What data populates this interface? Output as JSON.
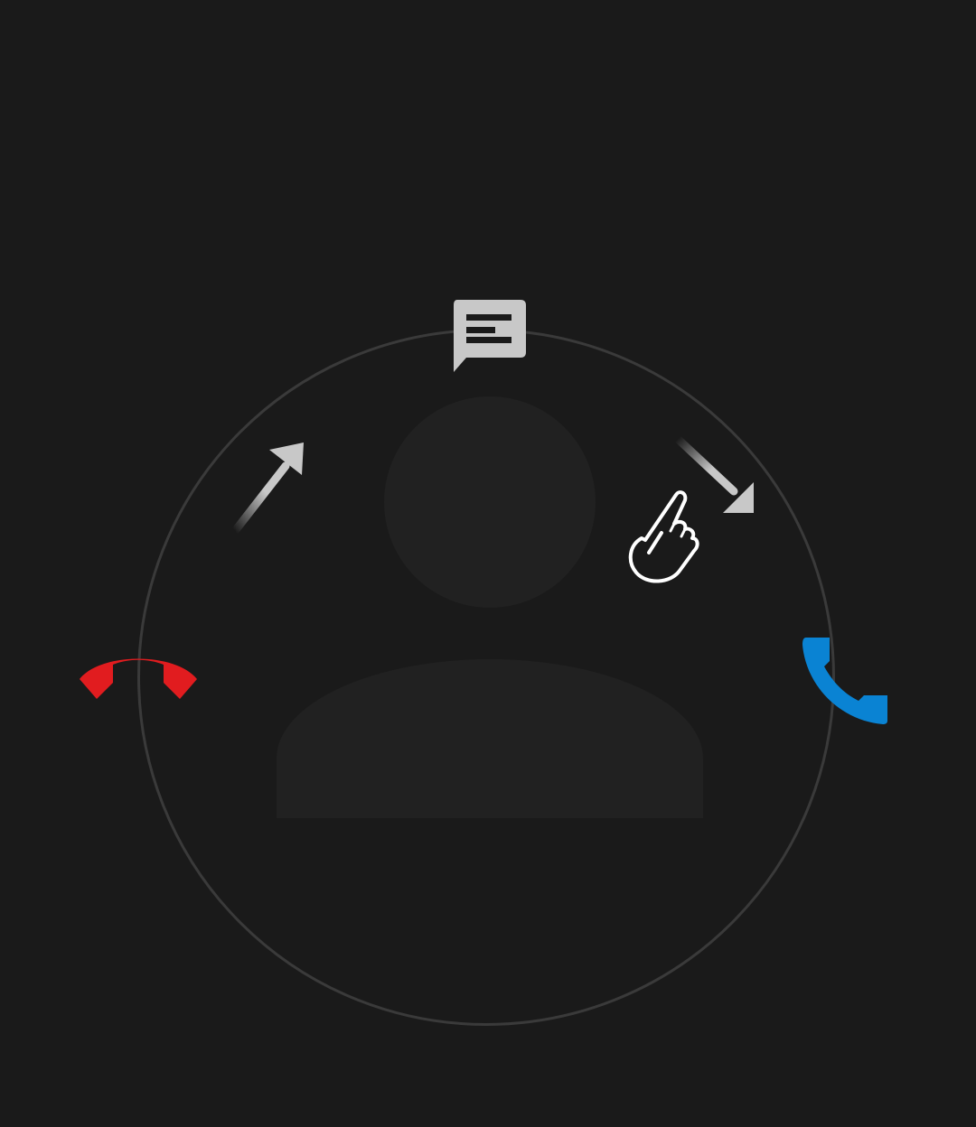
{
  "incoming_call": {
    "actions": {
      "message": {
        "icon": "message-icon",
        "color": "#c8c8c8"
      },
      "decline": {
        "icon": "decline-call-icon",
        "color": "#e11c1f"
      },
      "answer": {
        "icon": "answer-call-icon",
        "color": "#0a83d3"
      }
    },
    "hint": {
      "icons": [
        "swipe-up-left-arrow-icon",
        "swipe-down-right-arrow-icon",
        "pointing-hand-icon"
      ]
    },
    "caller_avatar": {
      "icon": "avatar-placeholder-icon"
    }
  },
  "colors": {
    "background": "#1a1a1a",
    "ring": "#3a3a3a",
    "avatar": "#212121",
    "arrow": "#c8c8c8",
    "hand_outline": "#ffffff"
  }
}
